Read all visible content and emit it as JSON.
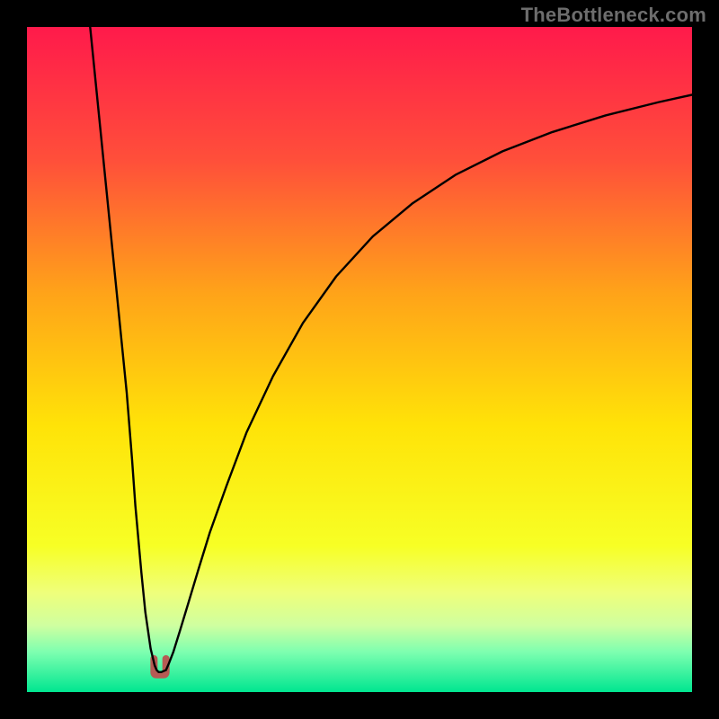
{
  "watermark": "TheBottleneck.com",
  "chart_data": {
    "type": "line",
    "title": "",
    "xlabel": "",
    "ylabel": "",
    "xlim": [
      0,
      100
    ],
    "ylim": [
      0,
      100
    ],
    "legend": false,
    "grid": false,
    "background_gradient": {
      "stops": [
        {
          "offset": 0.0,
          "color": "#ff1a4b"
        },
        {
          "offset": 0.2,
          "color": "#ff4f3a"
        },
        {
          "offset": 0.4,
          "color": "#ffa319"
        },
        {
          "offset": 0.6,
          "color": "#ffe308"
        },
        {
          "offset": 0.78,
          "color": "#f7ff25"
        },
        {
          "offset": 0.85,
          "color": "#efff7a"
        },
        {
          "offset": 0.9,
          "color": "#cfffa0"
        },
        {
          "offset": 0.94,
          "color": "#7dffb0"
        },
        {
          "offset": 1.0,
          "color": "#00e690"
        }
      ]
    },
    "series": [
      {
        "name": "curve",
        "color": "#000000",
        "width": 2.4,
        "x": [
          9.5,
          10,
          11,
          12,
          13,
          14,
          15,
          15.8,
          16.3,
          17.2,
          17.8,
          18.6,
          19.2,
          19.5,
          19.8,
          20.2,
          20.9,
          21.3,
          22.0,
          23.0,
          24.3,
          25.8,
          27.5,
          30.0,
          33.0,
          37.0,
          41.5,
          46.5,
          52.0,
          58.0,
          64.5,
          71.5,
          79.0,
          87.0,
          95.0,
          100.0
        ],
        "y": [
          100,
          95,
          85,
          75,
          65,
          55,
          45,
          35,
          28,
          18,
          12,
          6.5,
          4.0,
          3.3,
          3.0,
          3.0,
          3.3,
          4.2,
          6.0,
          9.2,
          13.5,
          18.5,
          24.0,
          31.0,
          39.0,
          47.5,
          55.5,
          62.5,
          68.5,
          73.5,
          77.8,
          81.3,
          84.2,
          86.7,
          88.7,
          89.8
        ]
      }
    ],
    "min_marker": {
      "x_center": 20.0,
      "x_half_width": 0.9,
      "y_bottom": 2.6,
      "y_top": 5.0,
      "color": "#b65a54",
      "note": "small U-shaped marker at the curve minimum"
    }
  }
}
